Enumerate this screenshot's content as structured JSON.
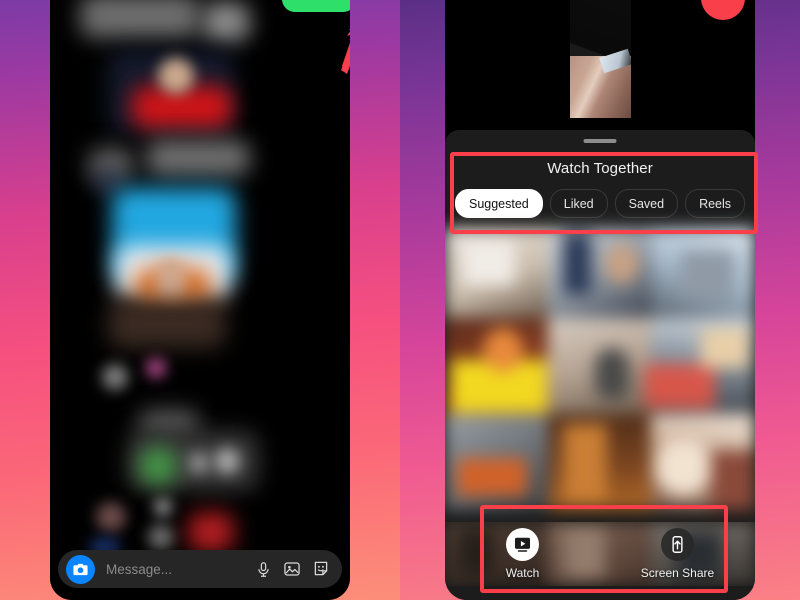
{
  "meta": {
    "accent_pink": "#f9404a",
    "accent_green": "#2ee06a",
    "accent_blue": "#0a84ff",
    "sheet_bg": "#1c1c1c",
    "screen_bg": "#000000"
  },
  "left_phone": {
    "name": "messenger-chat-screen",
    "green_button": {
      "label": "",
      "icon": "green-pill-button",
      "color": "#2ee06a"
    },
    "annotation_arrow": {
      "icon": "red-arrow-up-right",
      "color": "#f9404a"
    },
    "composer": {
      "camera_icon": "camera-icon",
      "placeholder": "Message...",
      "icons": [
        {
          "name": "microphone-icon",
          "label": "Microphone"
        },
        {
          "name": "photo-icon",
          "label": "Photos"
        },
        {
          "name": "sticker-icon",
          "label": "Stickers"
        }
      ]
    }
  },
  "right_phone": {
    "name": "video-call-watch-together-screen",
    "end_call_button": {
      "label": "",
      "icon": "end-call-button",
      "color": "#f9404a"
    },
    "self_view": {
      "name": "self-video-thumbnail"
    },
    "sheet": {
      "grabber": "drag-handle",
      "title": "Watch Together",
      "tabs": [
        {
          "label": "Suggested",
          "active": true
        },
        {
          "label": "Liked",
          "active": false
        },
        {
          "label": "Saved",
          "active": false
        },
        {
          "label": "Reels",
          "active": false
        }
      ]
    },
    "actions": [
      {
        "label": "Watch",
        "icon": "watch-play-icon",
        "style": "light"
      },
      {
        "label": "Screen Share",
        "icon": "screen-share-icon",
        "style": "dark"
      }
    ]
  },
  "annotations": [
    {
      "name": "highlight-watch-together-header",
      "shape": "rectangle",
      "color": "#f9404a"
    },
    {
      "name": "highlight-action-buttons",
      "shape": "rectangle",
      "color": "#f9404a"
    },
    {
      "name": "arrow-to-green-button",
      "shape": "arrow",
      "color": "#f9404a"
    }
  ]
}
